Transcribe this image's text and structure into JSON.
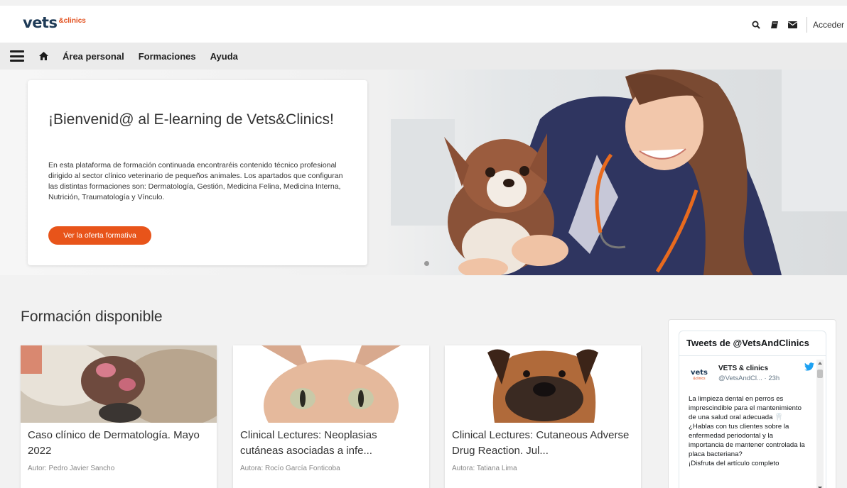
{
  "header": {
    "logo_main": "vets",
    "logo_sub": "&clinics",
    "search_icon": "search-icon",
    "book_icon": "book-icon",
    "mail_icon": "envelope-icon",
    "login_label": "Acceder"
  },
  "nav": {
    "menu_icon": "hamburger-menu-icon",
    "home_icon": "home-icon",
    "items": [
      {
        "label": "Área personal"
      },
      {
        "label": "Formaciones"
      },
      {
        "label": "Ayuda"
      }
    ]
  },
  "hero": {
    "title": "¡Bienvenid@ al E-learning de Vets&Clinics!",
    "text": "En esta plataforma de formación continuada encontraréis contenido técnico profesional dirigido al sector clínico veterinario de pequeños animales. Los apartados que configuran las distintas formaciones son: Dermatología, Gestión, Medicina Felina, Medicina Interna, Nutrición, Traumatología y Vínculo.",
    "button_label": "Ver la oferta formativa"
  },
  "courses": {
    "section_title": "Formación disponible",
    "items": [
      {
        "title": "Caso clínico de Dermatología. Mayo 2022",
        "author": "Autor: Pedro Javier Sancho"
      },
      {
        "title": "Clinical Lectures: Neoplasias cutáneas asociadas a infe...",
        "author": "Autora: Rocío García Fonticoba"
      },
      {
        "title": "Clinical Lectures: Cutaneous Adverse Drug Reaction. Jul...",
        "author": "Autora: Tatiana Lima"
      }
    ]
  },
  "twitter": {
    "header": "Tweets de @VetsAndClinics",
    "avatar_main": "vets",
    "avatar_sub": "&clinics",
    "account_name": "VETS & clinics",
    "handle": "@VetsAndCl... · 23h",
    "tweet_text": "La limpieza dental en perros es imprescindible para el mantenimiento de una salud oral adecuada 🦷\n¿Hablas con tus clientes sobre la enfermedad periodontal y la importancia de mantener controlada la placa bacteriana?\n¡Disfruta del artículo completo"
  },
  "colors": {
    "accent": "#e8541a",
    "brand_dark": "#1f3b57",
    "twitter_blue": "#1da1f2"
  }
}
